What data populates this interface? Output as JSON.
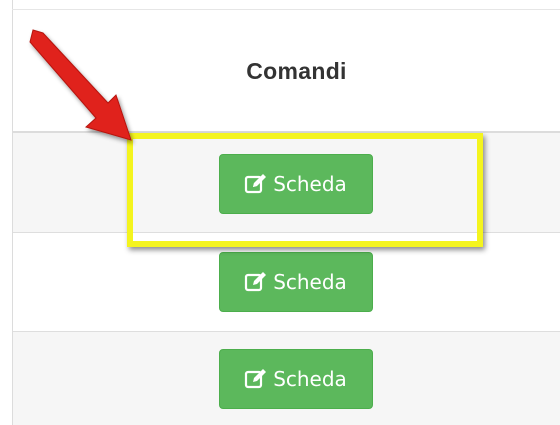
{
  "table": {
    "header": "Comandi",
    "rows": [
      {
        "button_label": "Scheda",
        "icon": "edit-icon"
      },
      {
        "button_label": "Scheda",
        "icon": "edit-icon"
      },
      {
        "button_label": "Scheda",
        "icon": "edit-icon"
      }
    ]
  },
  "colors": {
    "button": "#5cb85c",
    "highlight": "#f4f41e",
    "arrow": "#e0201c"
  }
}
